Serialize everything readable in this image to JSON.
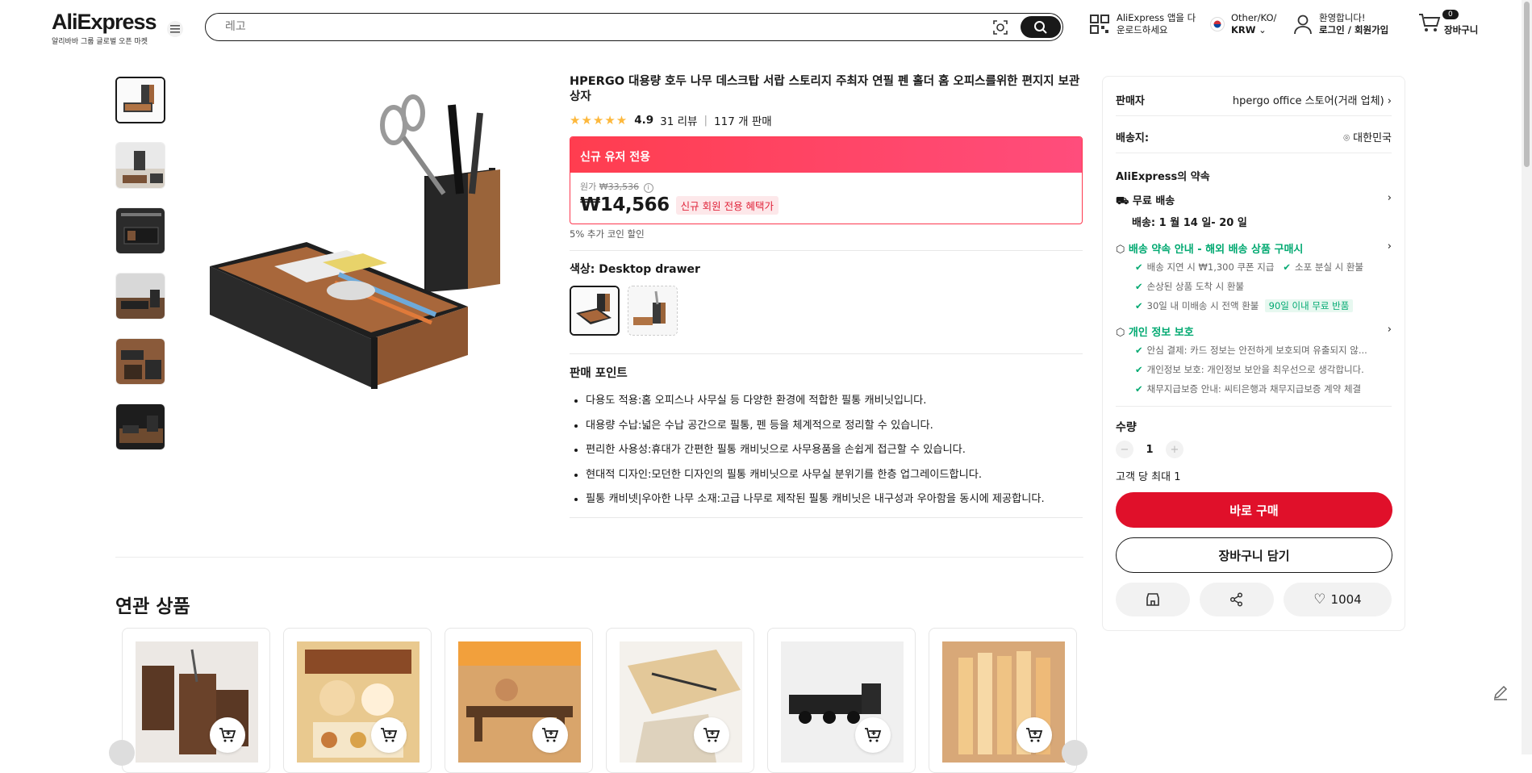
{
  "header": {
    "logo_text": "AliExpress",
    "logo_tagline": "알리바바 그룹 글로벌 오픈 마켓",
    "search_placeholder": "레고",
    "app_line1": "AliExpress 앱을 다",
    "app_line2": "운로드하세요",
    "locale_line1": "Other/KO/",
    "locale_line2": "KRW",
    "account_line1": "환영합니다!",
    "account_line2": "로그인 / 회원가입",
    "cart_count": "0",
    "cart_label": "장바구니"
  },
  "product": {
    "title": "HPERGO 대용량 호두 나무 데스크탑 서랍 스토리지 주최자 연필 펜 홀더 홈 오피스를위한 편지지 보관 상자",
    "rating": "4.9",
    "reviews": "31 리뷰",
    "sold": "117 개 판매",
    "promo_label": "신규 유저 전용",
    "orig_label": "원가",
    "orig_price": "₩33,536",
    "price": "₩14,566",
    "price_badge": "신규 회원 전용 혜택가",
    "coin_note": "5% 추가 코인 할인",
    "color_label": "색상: Desktop drawer",
    "selling_points_title": "판매 포인트",
    "selling_points": [
      "다용도 적용:홈 오피스나 사무실 등 다양한 환경에 적합한 필통 캐비닛입니다.",
      "대용량 수납:넓은 수납 공간으로 필통, 펜 등을 체계적으로 정리할 수 있습니다.",
      "편리한 사용성:휴대가 간편한 필통 캐비닛으로 사무용품을 손쉽게 접근할 수 있습니다.",
      "현대적 디자인:모던한 디자인의 필통 캐비닛으로 사무실 분위기를 한층 업그레이드합니다.",
      "필통 캐비넷|우아한 나무 소재:고급 나무로 제작된 필통 캐비닛은 내구성과 우아함을 동시에 제공합니다."
    ]
  },
  "sidebar": {
    "seller_label": "판매자",
    "seller_name": "hpergo office 스토어(거래 업체)",
    "ship_to_label": "배송지:",
    "ship_to_value": "대한민국",
    "promise_title": "AliExpress의 약속",
    "free_shipping": "무료 배송",
    "delivery_date": "배송: 1 월 14 일- 20 일",
    "guarantee_title": "배송 약속 안내 - 해외 배송 상품 구매시",
    "guarantee_1a": "배송 지연 시 ₩1,300 쿠폰 지급",
    "guarantee_1b": "소포 분실 시 환불",
    "guarantee_2": "손상된 상품 도착 시 환불",
    "guarantee_3": "30일 내 미배송 시 전액 환불",
    "guarantee_3_badge": "90일 이내 무료 반품",
    "privacy_title": "개인 정보 보호",
    "privacy_1": "안심 결제: 카드 정보는 안전하게 보호되며 유출되지 않...",
    "privacy_2": "개인정보 보호: 개인정보 보안을 최우선으로 생각합니다.",
    "privacy_3": "채무지급보증 안내: 씨티은행과 채무지급보증 계약 체결",
    "quantity_label": "수량",
    "quantity_value": "1",
    "quantity_limit": "고객 당 최대 1",
    "buy_now": "바로 구매",
    "add_to_cart": "장바구니 담기",
    "wishlist_count": "1004"
  },
  "related": {
    "title": "연관 상품"
  },
  "colors": {
    "accent_red": "#e0102a",
    "promo_pink": "#ff4d7c",
    "green": "#01a971",
    "star": "#fdb83c"
  }
}
